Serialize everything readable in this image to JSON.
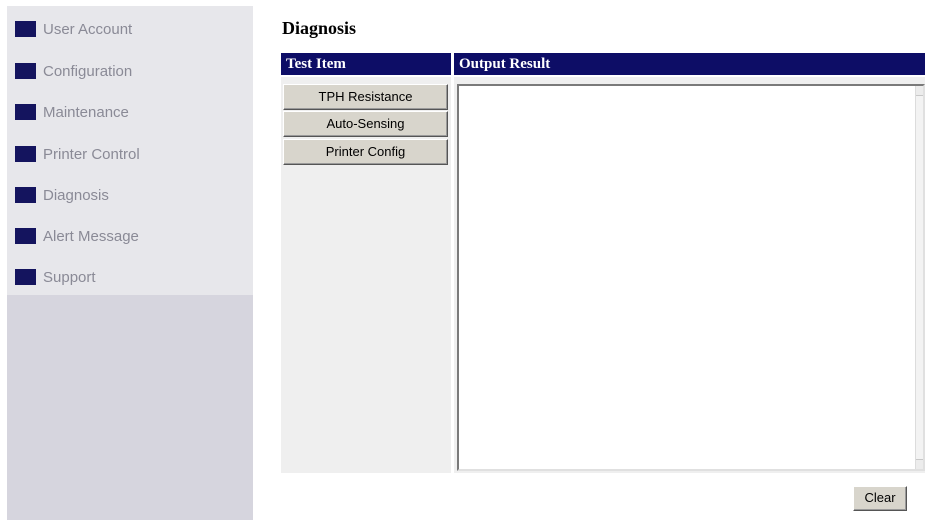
{
  "sidebar": {
    "items": [
      {
        "label": "User Account",
        "icon": "square-bullet-icon"
      },
      {
        "label": "Configuration",
        "icon": "square-bullet-icon"
      },
      {
        "label": "Maintenance",
        "icon": "square-bullet-icon"
      },
      {
        "label": "Printer Control",
        "icon": "square-bullet-icon"
      },
      {
        "label": "Diagnosis",
        "icon": "square-bullet-icon"
      },
      {
        "label": "Alert Message",
        "icon": "square-bullet-icon"
      },
      {
        "label": "Support",
        "icon": "square-bullet-icon"
      }
    ]
  },
  "main": {
    "title": "Diagnosis",
    "columns": {
      "test_item": "Test Item",
      "output_result": "Output Result"
    },
    "test_buttons": [
      "TPH Resistance",
      "Auto-Sensing",
      "Printer Config"
    ],
    "output_value": "",
    "clear_label": "Clear"
  },
  "colors": {
    "header_bg": "#0d0d66",
    "nav_square": "#14145e",
    "nav_text": "#8a8a96",
    "sidebar_menu_bg": "#e7e7eb",
    "sidebar_bg": "#d6d5de",
    "button_bg": "#d8d5cc"
  }
}
